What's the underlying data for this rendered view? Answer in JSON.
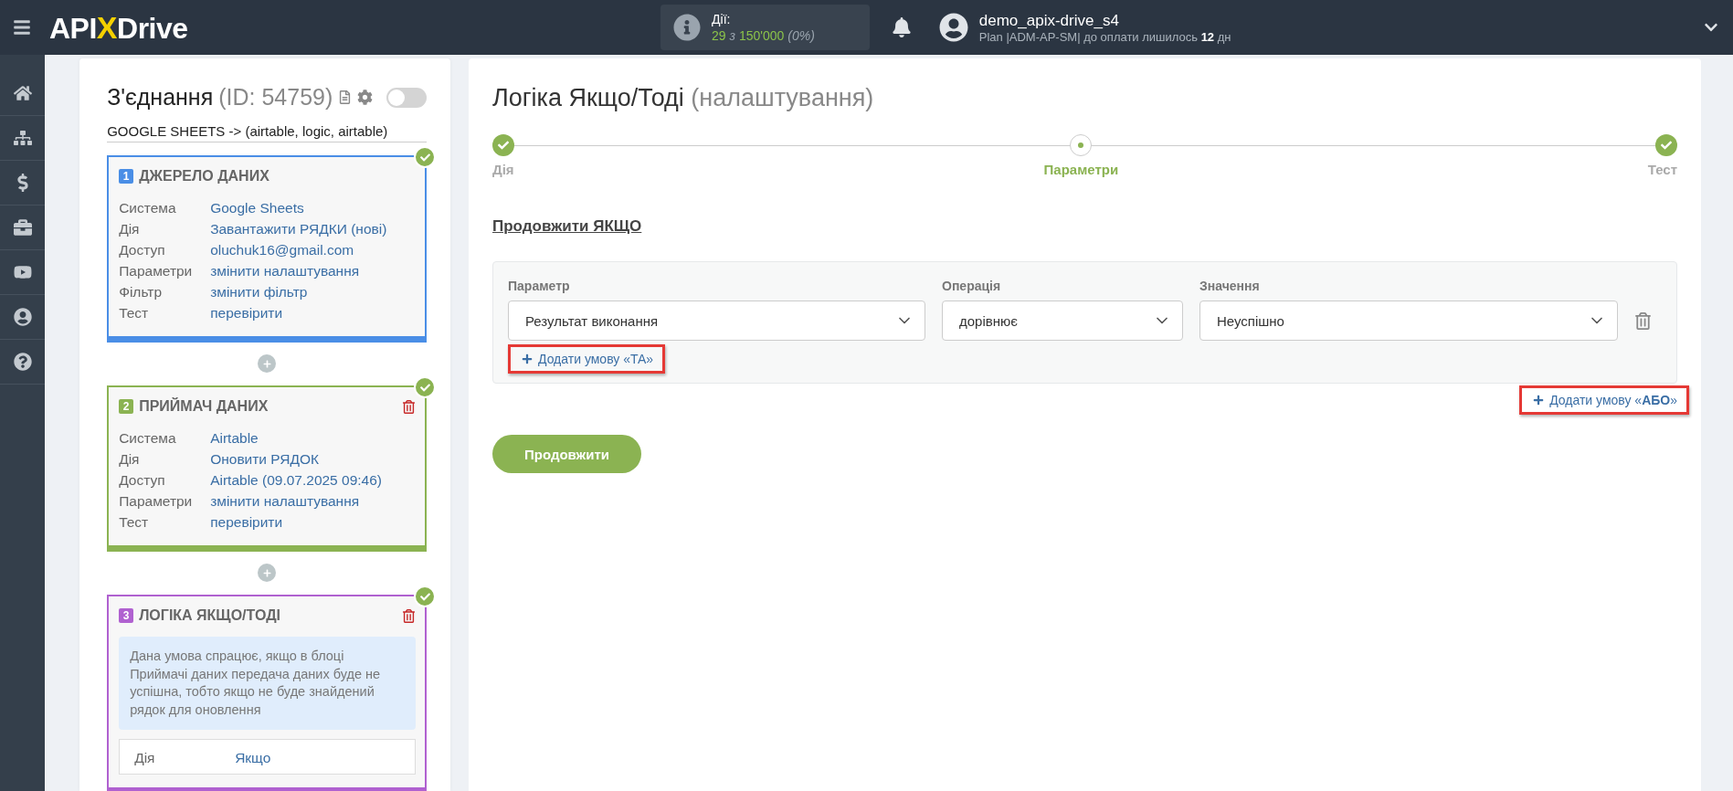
{
  "header": {
    "logo": {
      "left": "API",
      "mark": "X",
      "right": "Drive"
    },
    "actions": {
      "label": "Дії:",
      "used": "29",
      "separator": "з",
      "total": "150'000",
      "percent": "(0%)"
    },
    "user": {
      "name": "demo_apix-drive_s4",
      "plan": "Plan |ADM-AP-SM| до оплати лишилось **12** дн"
    }
  },
  "connection": {
    "title": "З'єднання",
    "id": "(ID: 54759)",
    "enabled": false,
    "name": "GOOGLE SHEETS -> (airtable, logic, airtable)"
  },
  "blocks": [
    {
      "number": "1",
      "title": "ДЖЕРЕЛО ДАНИХ",
      "color": "#4a8ee6",
      "done": true,
      "deletable": false,
      "rows": [
        {
          "label": "Система",
          "value": "Google Sheets"
        },
        {
          "label": "Дія",
          "value": "Завантажити РЯДКИ (нові)"
        },
        {
          "label": "Доступ",
          "value": "oluchuk16@gmail.com"
        },
        {
          "label": "Параметри",
          "value": "змінити налаштування"
        },
        {
          "label": "Фільтр",
          "value": "змінити фільтр"
        },
        {
          "label": "Тест",
          "value": "перевірити"
        }
      ]
    },
    {
      "number": "2",
      "title": "ПРИЙМАЧ ДАНИХ",
      "color": "#8bb352",
      "done": true,
      "deletable": true,
      "rows": [
        {
          "label": "Система",
          "value": "Airtable"
        },
        {
          "label": "Дія",
          "value": "Оновити РЯДОК"
        },
        {
          "label": "Доступ",
          "value": "Airtable (09.07.2025 09:46)"
        },
        {
          "label": "Параметри",
          "value": "змінити налаштування"
        },
        {
          "label": "Тест",
          "value": "перевірити"
        }
      ]
    },
    {
      "number": "3",
      "title": "ЛОГІКА ЯКЩО/ТОДІ",
      "color": "#b061d0",
      "done": true,
      "deletable": true,
      "note": "Дана умова спрацює, якщо в блоці Приймачі даних передача даних буде не успішна, тобто якщо не буде знайдений рядок для оновлення",
      "inner_rows": [
        {
          "label": "Дія",
          "value": "Якщо"
        }
      ]
    }
  ],
  "settings": {
    "title": "Логіка Якщо/Тоді",
    "subtitle": "(налаштування)",
    "steps": [
      {
        "label": "Дія",
        "done": true,
        "selected": false
      },
      {
        "label": "Параметри",
        "done": false,
        "selected": true
      },
      {
        "label": "Тест",
        "done": true,
        "selected": false
      }
    ],
    "section": "Продовжити ЯКЩО",
    "conditions": [
      {
        "fields": [
          {
            "label": "Параметр",
            "value": "Результат виконання"
          },
          {
            "label": "Операція",
            "value": "дорівнює"
          },
          {
            "label": "Значення",
            "value": "Неуспішно"
          }
        ]
      }
    ],
    "add_and": {
      "label": "Додати умову «ТА»",
      "highlighted": true
    },
    "add_or": {
      "label": "Додати умову «**АБО**»",
      "highlighted": true
    },
    "submit": "Продовжити"
  }
}
